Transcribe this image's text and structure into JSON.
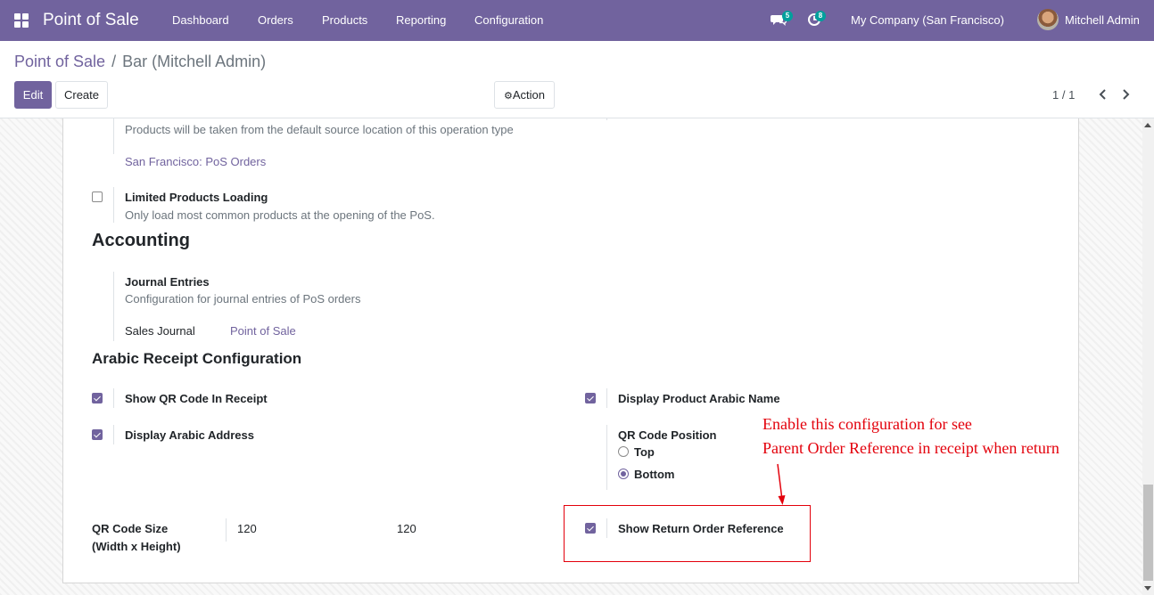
{
  "navbar": {
    "brand": "Point of Sale",
    "menu": [
      "Dashboard",
      "Orders",
      "Products",
      "Reporting",
      "Configuration"
    ],
    "messages_count": "5",
    "activities_count": "8",
    "company": "My Company (San Francisco)",
    "user": "Mitchell Admin"
  },
  "breadcrumb": {
    "parent": "Point of Sale",
    "separator": "/",
    "current": "Bar (Mitchell Admin)"
  },
  "buttons": {
    "edit": "Edit",
    "create": "Create",
    "action": "Action"
  },
  "pager": {
    "value": "1 / 1"
  },
  "form": {
    "operation_type_help": "Products will be taken from the default source location of this operation type",
    "operation_type_value": "San Francisco: PoS Orders",
    "limited_loading": {
      "label": "Limited Products Loading",
      "help": "Only load most common products at the opening of the PoS.",
      "checked": false
    },
    "accounting": {
      "title": "Accounting",
      "journal_entries_label": "Journal Entries",
      "journal_entries_help": "Configuration for journal entries of PoS orders",
      "sales_journal_label": "Sales Journal",
      "sales_journal_value": "Point of Sale"
    },
    "arabic": {
      "title": "Arabic Receipt Configuration",
      "show_qr": {
        "label": "Show QR Code In Receipt",
        "checked": true
      },
      "display_product_arabic": {
        "label": "Display Product Arabic Name",
        "checked": true
      },
      "display_arabic_address": {
        "label": "Display Arabic Address",
        "checked": true
      },
      "qr_position": {
        "label": "QR Code Position",
        "options": [
          "Top",
          "Bottom"
        ],
        "selected": "Bottom"
      },
      "qr_size": {
        "label_line1": "QR Code Size",
        "label_line2": "(Width x Height)",
        "width": "120",
        "height": "120"
      },
      "show_return_ref": {
        "label": "Show Return Order Reference",
        "checked": true
      }
    }
  },
  "annotation": {
    "line1": "Enable this configuration for see",
    "line2": "Parent Order Reference in receipt when return"
  },
  "colors": {
    "brand": "#71639e",
    "annotation": "#e3000b",
    "badge": "#00a09d"
  }
}
